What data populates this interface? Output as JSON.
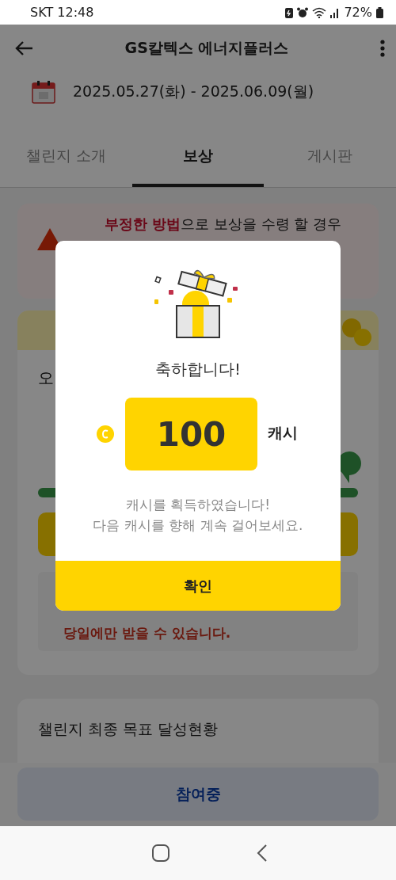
{
  "status_bar": {
    "carrier_time": "SKT 12:48",
    "battery": "72%"
  },
  "header": {
    "title": "GS칼텍스 에너지플러스"
  },
  "period": {
    "dates": "2025.05.27(화) - 2025.06.09(월)"
  },
  "tabs": [
    {
      "label": "챌린지 소개",
      "selected": false
    },
    {
      "label": "보상",
      "selected": true
    },
    {
      "label": "게시판",
      "selected": false
    }
  ],
  "warning": {
    "text": "**부정한 방법**으로 보상을 수령 할 경우"
  },
  "today_card": {
    "title": "오",
    "progress": {
      "level": 1
    },
    "notice": "당일에만 받을 수 있습니다."
  },
  "final_card": {
    "title": "챌린지 최종 목표 달성현황"
  },
  "join_button": "참여중",
  "dialog": {
    "title": "축하합니다!",
    "amount": "100",
    "unit": "캐시",
    "message_lines": [
      "캐시를 획득하였습니다!",
      "다음 캐시를 향해 계속 걸어보세요."
    ],
    "confirm": "확인"
  }
}
